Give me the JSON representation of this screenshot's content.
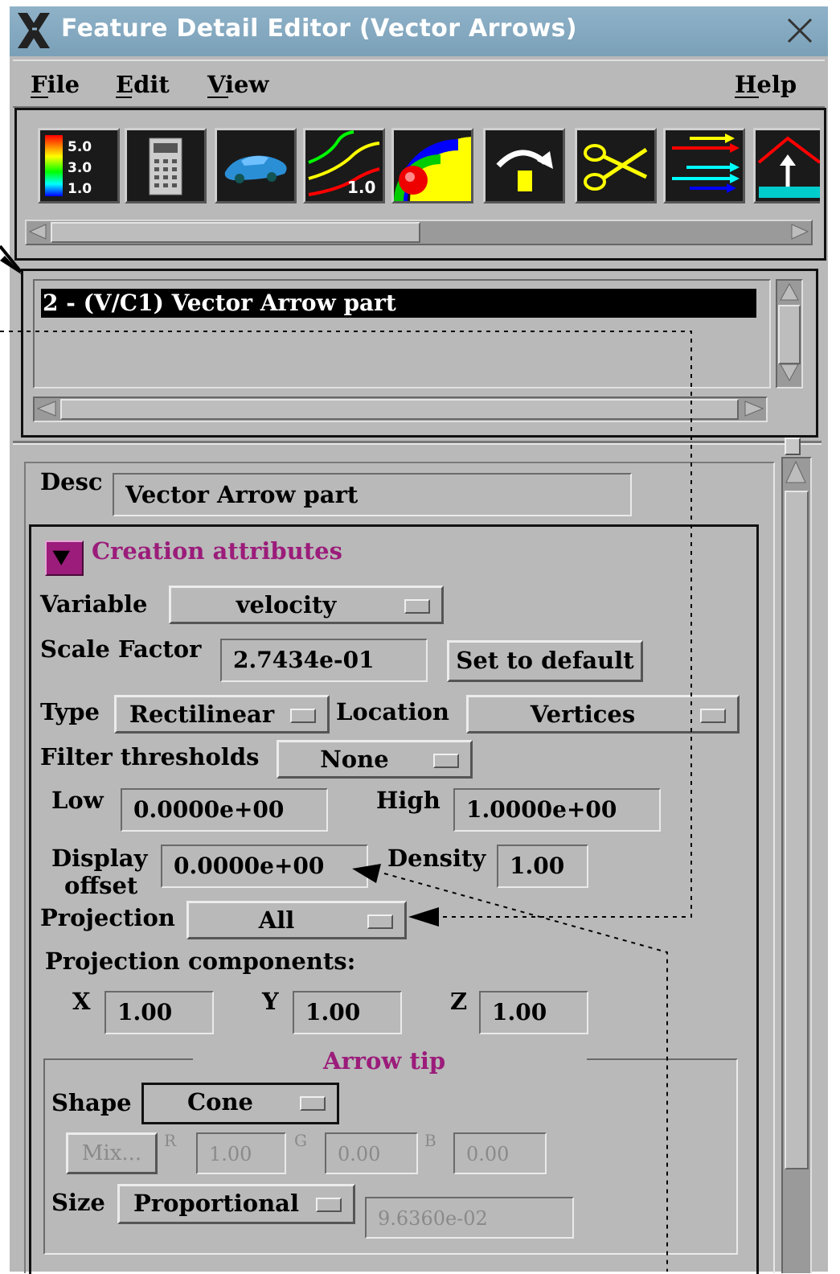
{
  "window": {
    "title": "Feature Detail Editor (Vector Arrows)"
  },
  "menu": {
    "file": "File",
    "edit": "Edit",
    "view": "View",
    "help": "Help"
  },
  "toolbar": {
    "legend_values": [
      "5.0",
      "3.0",
      "1.0"
    ],
    "contour_label": "1.0",
    "icons": [
      "color-legend-icon",
      "calculator-icon",
      "car-model-icon",
      "contour-lines-icon",
      "isosurface-icon",
      "elevation-arrow-icon",
      "clip-scissors-icon",
      "vector-arrows-icon",
      "extrude-icon"
    ]
  },
  "parts": {
    "items": [
      "2 - (V/C1) Vector Arrow part"
    ]
  },
  "desc": {
    "label": "Desc",
    "value": "Vector Arrow part"
  },
  "creation": {
    "title": "Creation attributes",
    "variable_label": "Variable",
    "variable_value": "velocity",
    "scale_label": "Scale Factor",
    "scale_value": "2.7434e-01",
    "set_default": "Set to default",
    "type_label": "Type",
    "type_value": "Rectilinear",
    "location_label": "Location",
    "location_value": "Vertices",
    "filter_label": "Filter thresholds",
    "filter_value": "None",
    "low_label": "Low",
    "low_value": "0.0000e+00",
    "high_label": "High",
    "high_value": "1.0000e+00",
    "display_label_1": "Display",
    "display_label_2": "offset",
    "display_value": "0.0000e+00",
    "density_label": "Density",
    "density_value": "1.00",
    "projection_label": "Projection",
    "projection_value": "All",
    "proj_components_label": "Projection components:",
    "x_label": "X",
    "x_value": "1.00",
    "y_label": "Y",
    "y_value": "1.00",
    "z_label": "Z",
    "z_value": "1.00"
  },
  "arrow_tip": {
    "title": "Arrow tip",
    "shape_label": "Shape",
    "shape_value": "Cone",
    "mix_label": "Mix...",
    "r_label": "R",
    "r_value": "1.00",
    "g_label": "G",
    "g_value": "0.00",
    "b_label": "B",
    "b_value": "0.00",
    "size_label": "Size",
    "size_value": "Proportional",
    "size_number": "9.6360e-02"
  },
  "colors": {
    "title_bar": "#7aa0b8",
    "accent": "#9b1c7a",
    "window_bg": "#b9b9b9"
  }
}
